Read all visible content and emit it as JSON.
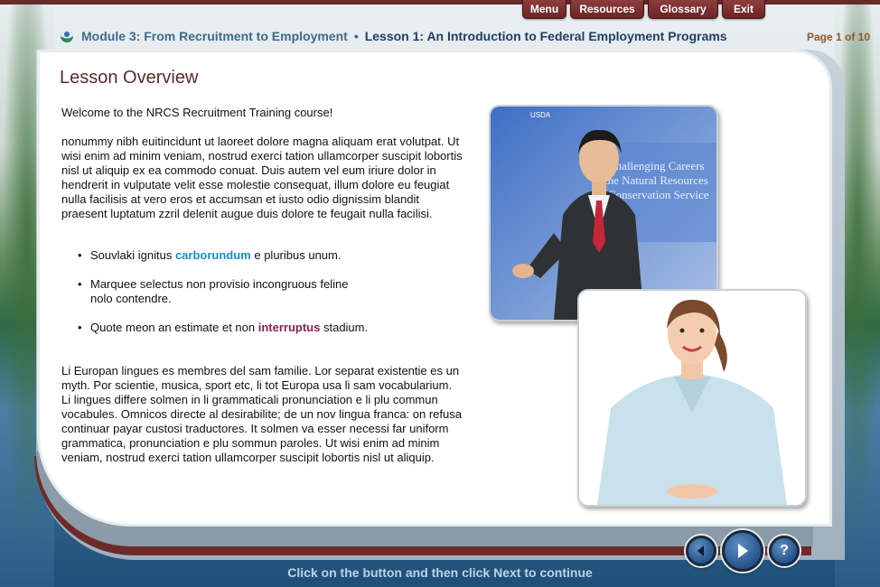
{
  "nav": {
    "menu_label": "Menu",
    "resources_label": "Resources",
    "glossary_label": "Glossary",
    "exit_label": "Exit"
  },
  "header": {
    "module": "Module 3: From Recruitment to Employment",
    "separator": "•",
    "lesson": "Lesson 1: An Introduction to Federal Employment Programs",
    "page_indicator": "Page 1 of 10"
  },
  "lesson": {
    "title": "Lesson Overview",
    "welcome": "Welcome to the NRCS Recruitment Training course!",
    "paragraph1": "nonummy nibh euitincidunt ut laoreet dolore magna aliquam erat volutpat. Ut wisi enim ad minim veniam, nostrud exerci tation ullamcorper suscipit lobortis nisl ut aliquip ex ea commodo conuat. Duis autem vel eum iriure dolor in hendrerit in vulputate velit esse molestie consequat, illum dolore eu feugiat nulla facilisis at vero eros et accumsan et iusto odio dignissim blandit praesent luptatum zzril delenit augue duis dolore te feugait nulla facilisi.",
    "bullets": [
      {
        "before": "Souvlaki ignitus ",
        "keyword": "carborundum",
        "after": " e pluribus unum."
      },
      {
        "before": "Marquee selectus non provisio incongruous feline nolo contendre.",
        "keyword": "",
        "after": ""
      },
      {
        "before": "Quote meon an estimate et non ",
        "keyword": "interruptus",
        "after": " stadium."
      }
    ],
    "paragraph2": "Li Europan lingues es membres del sam familie. Lor separat existentie es un myth. Por scientie, musica, sport etc, li tot Europa usa li sam vocabularium. Li lingues differe solmen in li grammaticali pronunciation e li plu commun vocabules. Omnicos directe al desirabilite; de un nov lingua franca: on refusa continuar payar custosi traductores. It solmen va esser necessi far uniform grammatica, pronunciation e plu sommun paroles. Ut wisi enim ad minim veniam, nostrud exerci tation ullamcorper suscipit lobortis nisl ut aliquip."
  },
  "photos": {
    "photo1_sign": "Challenging Careers\nthe Natural Resources\nConservation Service",
    "photo1_tag": "USDA"
  },
  "controls": {
    "help_label": "?"
  },
  "instruction": "Click on the button and then click Next to continue",
  "colors": {
    "maroon": "#6e2a2a",
    "header_blue": "#3b6b8e",
    "keyword_blue": "#1a8ec9",
    "keyword_maroon": "#8a1f55",
    "page_indicator": "#8b5a2b"
  }
}
